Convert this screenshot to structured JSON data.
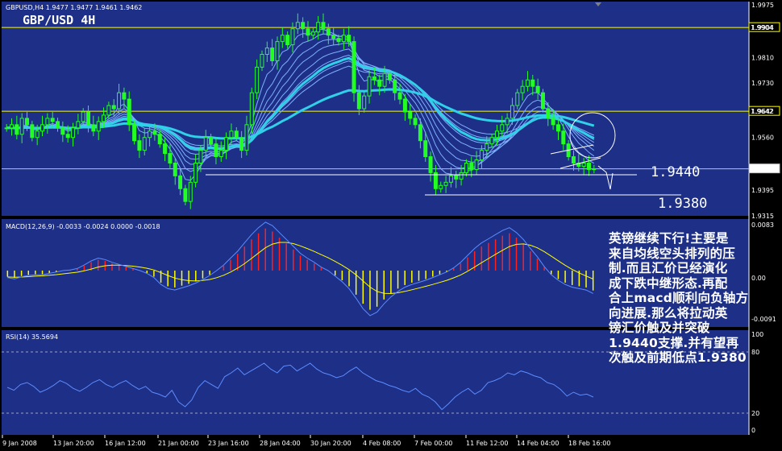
{
  "header": {
    "symbol_info": "GBPUSD,H4  1.9477 1.9477 1.9461 1.9462",
    "chart_title": "GBP/USD 4H"
  },
  "chart_data": [
    {
      "type": "line",
      "name": "price",
      "ylim": [
        1.9315,
        1.9985
      ],
      "y_ticks": [
        "1.9975",
        "1.9904",
        "1.9810",
        "1.9730",
        "1.9642",
        "1.9560",
        "1.9462",
        "1.9395",
        "1.9315"
      ],
      "x_ticks": [
        "9 Jan 2008",
        "13 Jan 20:00",
        "16 Jan 12:00",
        "21 Jan 00:00",
        "23 Jan 16:00",
        "28 Jan 04:00",
        "30 Jan 20:00",
        "4 Feb 08:00",
        "7 Feb 00:00",
        "11 Feb 12:00",
        "14 Feb 04:00",
        "18 Feb 16:00"
      ],
      "horizontal_levels": [
        {
          "value": "1.9904",
          "color": "#ffff00"
        },
        {
          "value": "1.9642",
          "color": "#ffff00"
        },
        {
          "value": "1.9462",
          "color": "#c0c0c0"
        }
      ],
      "annotations": {
        "support_1": "1.9440",
        "support_2": "1.9380"
      },
      "close": [
        1.959,
        1.96,
        1.957,
        1.962,
        1.96,
        1.956,
        1.958,
        1.96,
        1.962,
        1.961,
        1.959,
        1.957,
        1.956,
        1.959,
        1.961,
        1.964,
        1.96,
        1.958,
        1.961,
        1.963,
        1.966,
        1.965,
        1.97,
        1.968,
        1.96,
        1.955,
        1.952,
        1.956,
        1.958,
        1.957,
        1.954,
        1.951,
        1.948,
        1.944,
        1.94,
        1.936,
        1.942,
        1.948,
        1.952,
        1.956,
        1.954,
        1.95,
        1.952,
        1.956,
        1.958,
        1.956,
        1.952,
        1.96,
        1.97,
        1.978,
        1.982,
        1.984,
        1.98,
        1.986,
        1.988,
        1.985,
        1.99,
        1.992,
        1.99,
        1.988,
        1.989,
        1.992,
        1.99,
        1.988,
        1.987,
        1.986,
        1.988,
        1.986,
        1.97,
        1.965,
        1.969,
        1.975,
        1.974,
        1.972,
        1.976,
        1.974,
        1.97,
        1.968,
        1.964,
        1.962,
        1.96,
        1.955,
        1.95,
        1.945,
        1.94,
        1.941,
        1.942,
        1.944,
        1.943,
        1.945,
        1.948,
        1.946,
        1.949,
        1.952,
        1.954,
        1.956,
        1.958,
        1.96,
        1.962,
        1.966,
        1.97,
        1.972,
        1.974,
        1.972,
        1.97,
        1.965,
        1.962,
        1.96,
        1.958,
        1.954,
        1.95,
        1.948,
        1.947,
        1.948,
        1.946,
        1.9462
      ]
    },
    {
      "type": "bar",
      "name": "MACD",
      "label": "MACD(12,26,9) -0.0033 -0.0024 0.0000 -0.0018",
      "y_ticks": [
        "0.0083",
        "0.00",
        "-0.0091"
      ],
      "values": [
        -0.001,
        -0.0012,
        -0.0009,
        -0.0007,
        -0.0006,
        -0.0006,
        -0.0004,
        -0.0002,
        0.0,
        0.0001,
        0.0003,
        0.0008,
        0.0014,
        0.0018,
        0.0016,
        0.0012,
        0.0009,
        0.0006,
        0.0003,
        0.0,
        -0.0004,
        -0.001,
        -0.002,
        -0.0026,
        -0.0028,
        -0.0025,
        -0.0022,
        -0.0018,
        -0.0013,
        -0.0007,
        0.0,
        0.0008,
        0.0018,
        0.0028,
        0.004,
        0.0052,
        0.0062,
        0.007,
        0.0065,
        0.0055,
        0.0045,
        0.0035,
        0.0025,
        0.0018,
        0.0012,
        0.0005,
        0.0,
        -0.0008,
        -0.0016,
        -0.0026,
        -0.004,
        -0.0055,
        -0.0065,
        -0.006,
        -0.0048,
        -0.0038,
        -0.003,
        -0.0024,
        -0.002,
        -0.0017,
        -0.0014,
        -0.001,
        -0.0006,
        -0.0002,
        0.0004,
        0.0012,
        0.0022,
        0.0032,
        0.004,
        0.0046,
        0.0052,
        0.0058,
        0.0062,
        0.0055,
        0.0045,
        0.0032,
        0.002,
        0.0006,
        -0.0006,
        -0.0014,
        -0.002,
        -0.0024,
        -0.0026,
        -0.0028,
        -0.0033
      ]
    },
    {
      "type": "line",
      "name": "RSI",
      "label": "RSI(14) 35.5694",
      "y_ticks": [
        "100",
        "80",
        "20",
        "0"
      ],
      "values": [
        45,
        42,
        48,
        50,
        46,
        40,
        43,
        47,
        52,
        49,
        44,
        41,
        45,
        50,
        53,
        48,
        45,
        49,
        52,
        47,
        43,
        46,
        40,
        38,
        35,
        42,
        30,
        25,
        32,
        45,
        52,
        48,
        44,
        56,
        60,
        65,
        58,
        62,
        66,
        70,
        64,
        60,
        67,
        68,
        62,
        66,
        70,
        64,
        60,
        58,
        55,
        57,
        62,
        66,
        60,
        56,
        52,
        50,
        47,
        45,
        42,
        40,
        44,
        38,
        35,
        30,
        22,
        28,
        35,
        40,
        44,
        38,
        42,
        50,
        52,
        55,
        60,
        58,
        62,
        60,
        57,
        55,
        50,
        48,
        43,
        36,
        40,
        37,
        38,
        35
      ]
    }
  ],
  "annotation_text": [
    "英镑继续下行!主要是",
    "来自均线空头排列的压",
    "制.而且汇价已经演化",
    "成下跌中继形态.再配",
    "合上macd顺利向负轴方",
    "向进展.那么将拉动英",
    "镑汇价触及并突破",
    "1.9440支撑.并有望再",
    "次触及前期低点1.9380"
  ]
}
